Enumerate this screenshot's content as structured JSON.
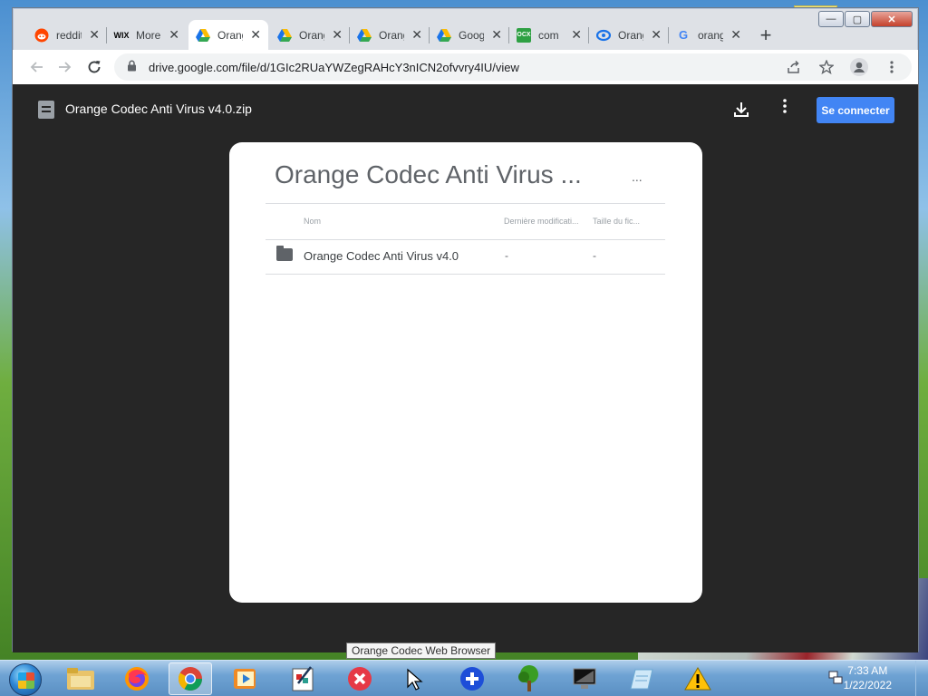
{
  "window": {
    "controls": {
      "minimize": "—",
      "maximize": "▢",
      "close": "✕"
    }
  },
  "tabs": [
    {
      "label": "reddit",
      "favicon_text": "",
      "favicon_color": "#ff4500",
      "active": false
    },
    {
      "label": "More",
      "favicon_text": "WIX",
      "favicon_color": "#000000",
      "active": false
    },
    {
      "label": "Orange",
      "favicon_text": "",
      "favicon_color": "#1a73e8",
      "active": true
    },
    {
      "label": "Orange",
      "favicon_text": "",
      "favicon_color": "#1a73e8",
      "active": false
    },
    {
      "label": "Orange",
      "favicon_text": "",
      "favicon_color": "#1a73e8",
      "active": false
    },
    {
      "label": "Google",
      "favicon_text": "",
      "favicon_color": "#1a73e8",
      "active": false
    },
    {
      "label": "com",
      "favicon_text": "OCX",
      "favicon_color": "#2ea043",
      "active": false
    },
    {
      "label": "Orange",
      "favicon_text": "",
      "favicon_color": "#1a73e8",
      "active": false
    },
    {
      "label": "orange",
      "favicon_text": "G",
      "favicon_color": "#4285f4",
      "active": false
    }
  ],
  "toolbar": {
    "url": "drive.google.com/file/d/1GIc2RUaYWZegRAHcY3nICN2ofvvry4IU/view"
  },
  "drive": {
    "file_name": "Orange Codec Anti Virus v4.0.zip",
    "signin_label": "Se connecter",
    "card_title": "Orange Codec Anti Virus ...",
    "card_ellipsis": "...",
    "columns": {
      "name": "Nom",
      "modified": "Dernière modificati...",
      "size": "Taille du fic..."
    },
    "rows": [
      {
        "name": "Orange Codec Anti Virus v4.0",
        "modified": "-",
        "size": "-"
      }
    ]
  },
  "tooltip": "Orange Codec Web Browser",
  "taskbar": {
    "time": "7:33 AM",
    "date": "1/22/2022",
    "apps": [
      "explorer-icon",
      "firefox-icon",
      "chrome-icon",
      "media-icon",
      "paint-icon",
      "stop-icon",
      "cursor-icon",
      "plus-icon",
      "tree-icon",
      "monitor-icon",
      "notepad-icon",
      "warning-icon"
    ]
  }
}
